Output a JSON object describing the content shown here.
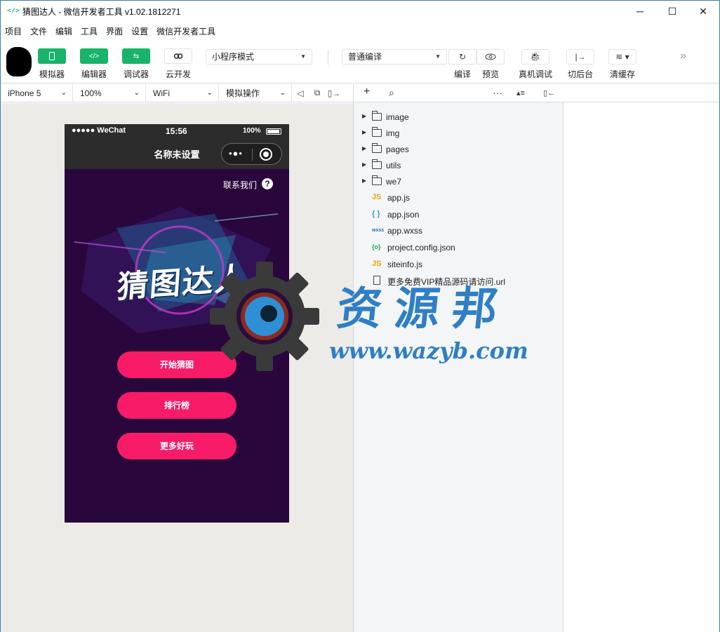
{
  "window": {
    "title": "猜图达人 - 微信开发者工具 v1.02.1812271",
    "minimize": "─",
    "maximize": "☐",
    "close": "✕"
  },
  "menu": [
    "项目",
    "文件",
    "编辑",
    "工具",
    "界面",
    "设置",
    "微信开发者工具"
  ],
  "toolbar": {
    "simulator_label": "模拟器",
    "editor_label": "编辑器",
    "debugger_label": "调试器",
    "cloud_label": "云开发",
    "mode_select": "小程序模式",
    "compile_select": "普通编译",
    "compile_label": "编译",
    "preview_label": "预览",
    "remote_debug_label": "真机调试",
    "background_label": "切后台",
    "clear_cache_label": "清缓存"
  },
  "devicebar": {
    "device": "iPhone 5",
    "zoom": "100%",
    "network": "WiFi",
    "operation": "模拟操作"
  },
  "phone": {
    "signal": "●●●●● WeChat",
    "time": "15:56",
    "battery": "100%",
    "nav_title": "名称未设置",
    "contact": "联系我们",
    "help": "?",
    "hero_title": "猜图达人",
    "buttons": [
      "开始猜图",
      "排行榜",
      "更多好玩"
    ]
  },
  "watermark": {
    "text": "资源邦",
    "url": "www.wazyb.com"
  },
  "file_tree": {
    "folders": [
      "image",
      "img",
      "pages",
      "utils",
      "we7"
    ],
    "files": [
      {
        "badge": "JS",
        "name": "app.js",
        "color": "#e6a700"
      },
      {
        "badge": "{ }",
        "name": "app.json",
        "color": "#3a9ad9"
      },
      {
        "badge": "wxss",
        "name": "app.wxss",
        "color": "#2b6cb0"
      },
      {
        "badge": "{o}",
        "name": "project.config.json",
        "color": "#19a35b"
      },
      {
        "badge": "JS",
        "name": "siteinfo.js",
        "color": "#e6a700"
      },
      {
        "badge": "",
        "name": "更多免费VIP精品源码请访问.url",
        "color": "#444"
      }
    ]
  },
  "colors": {
    "accent": "#19b36b",
    "phone_bg": "#29073d",
    "button": "#f81b67",
    "watermark": "#2f7fc4"
  }
}
